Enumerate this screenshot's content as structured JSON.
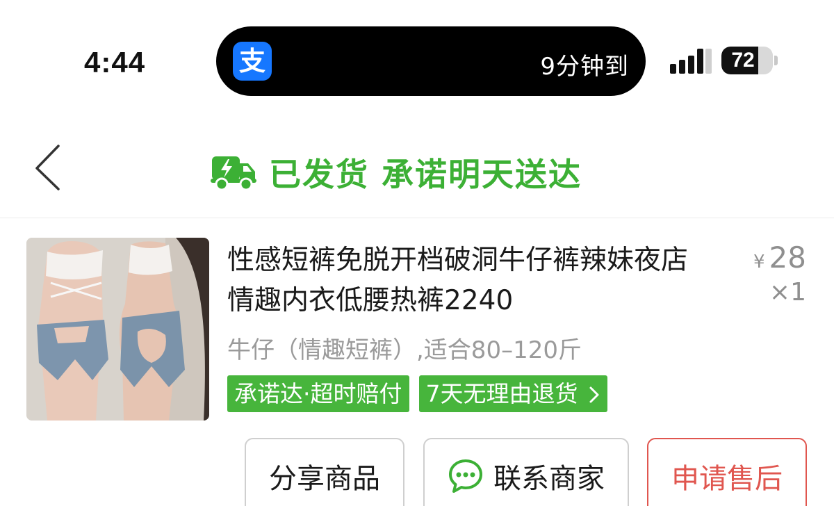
{
  "status_bar": {
    "time": "4:44",
    "island_app_icon": "支",
    "island_text": "9分钟到",
    "battery": "72",
    "battery_level": 0.72
  },
  "header": {
    "back_icon": "chevron-left-icon",
    "title": "已发货 承诺明天送达",
    "accent_color": "#3cb035"
  },
  "product": {
    "title": "性感短裤免脱开档破洞牛仔裤辣妹夜店情趣内衣低腰热裤2240",
    "currency": "¥",
    "price": "28",
    "quantity": "×1",
    "spec": "牛仔（情趣短裤）,适合80–120斤",
    "tags": [
      "承诺达·超时赔付",
      "7天无理由退货"
    ],
    "tag_color": "#47b53c"
  },
  "actions": {
    "share": "分享商品",
    "contact": "联系商家",
    "after_sale": "申请售后",
    "after_sale_color": "#e0564f"
  }
}
